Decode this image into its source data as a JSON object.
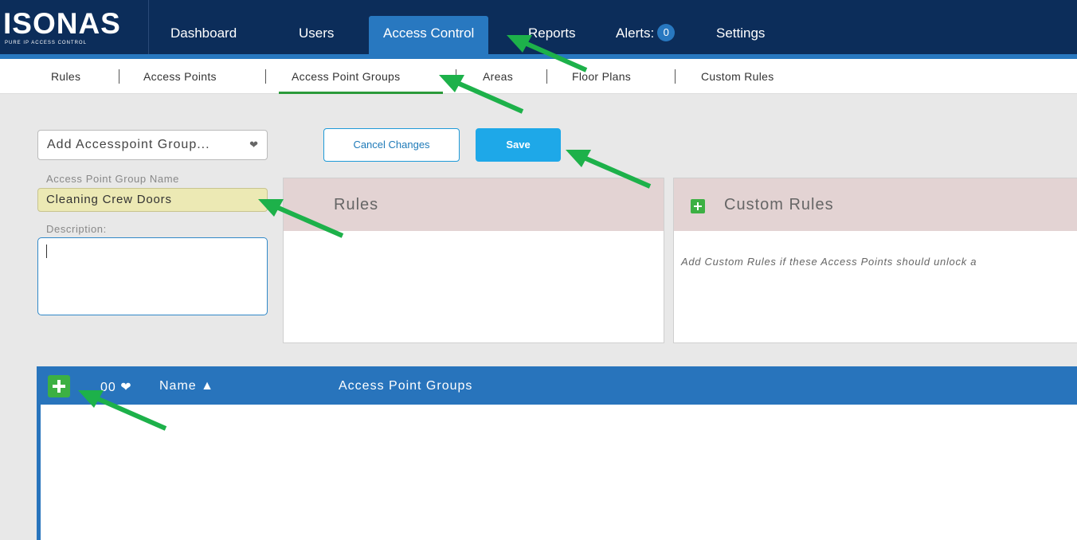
{
  "app": {
    "logo_text": "ISONAS",
    "logo_tagline": "PURE IP ACCESS CONTROL"
  },
  "nav": {
    "items": [
      {
        "label": "Dashboard"
      },
      {
        "label": "Users"
      },
      {
        "label": "Access Control",
        "active": true
      },
      {
        "label": "Reports"
      },
      {
        "label": "Alerts:"
      },
      {
        "label": "Settings"
      }
    ],
    "alerts_count": "0"
  },
  "subnav": {
    "items": [
      {
        "label": "Rules"
      },
      {
        "label": "Access Points"
      },
      {
        "label": "Access Point Groups",
        "active": true
      },
      {
        "label": "Areas"
      },
      {
        "label": "Floor Plans"
      },
      {
        "label": "Custom Rules"
      }
    ]
  },
  "form": {
    "select_value": "Add Accesspoint Group...",
    "cancel_label": "Cancel Changes",
    "save_label": "Save",
    "name_label": "Access Point Group Name",
    "name_value": "Cleaning Crew Doors",
    "description_label": "Description:",
    "description_value": ""
  },
  "panels": {
    "rules_title": "Rules",
    "custom_rules_title": "Custom Rules",
    "custom_rules_note": "Add Custom Rules if these Access Points should unlock a"
  },
  "table": {
    "count_selector": "00",
    "columns": [
      {
        "label": "Name ▲"
      },
      {
        "label": "Access Point Groups"
      }
    ],
    "rows": []
  },
  "colors": {
    "nav_bg": "#0c2d5a",
    "accent_blue": "#2878c0",
    "save_blue": "#1ea8e8",
    "add_green": "#3cb043",
    "annotation_arrow": "#1db14a"
  }
}
